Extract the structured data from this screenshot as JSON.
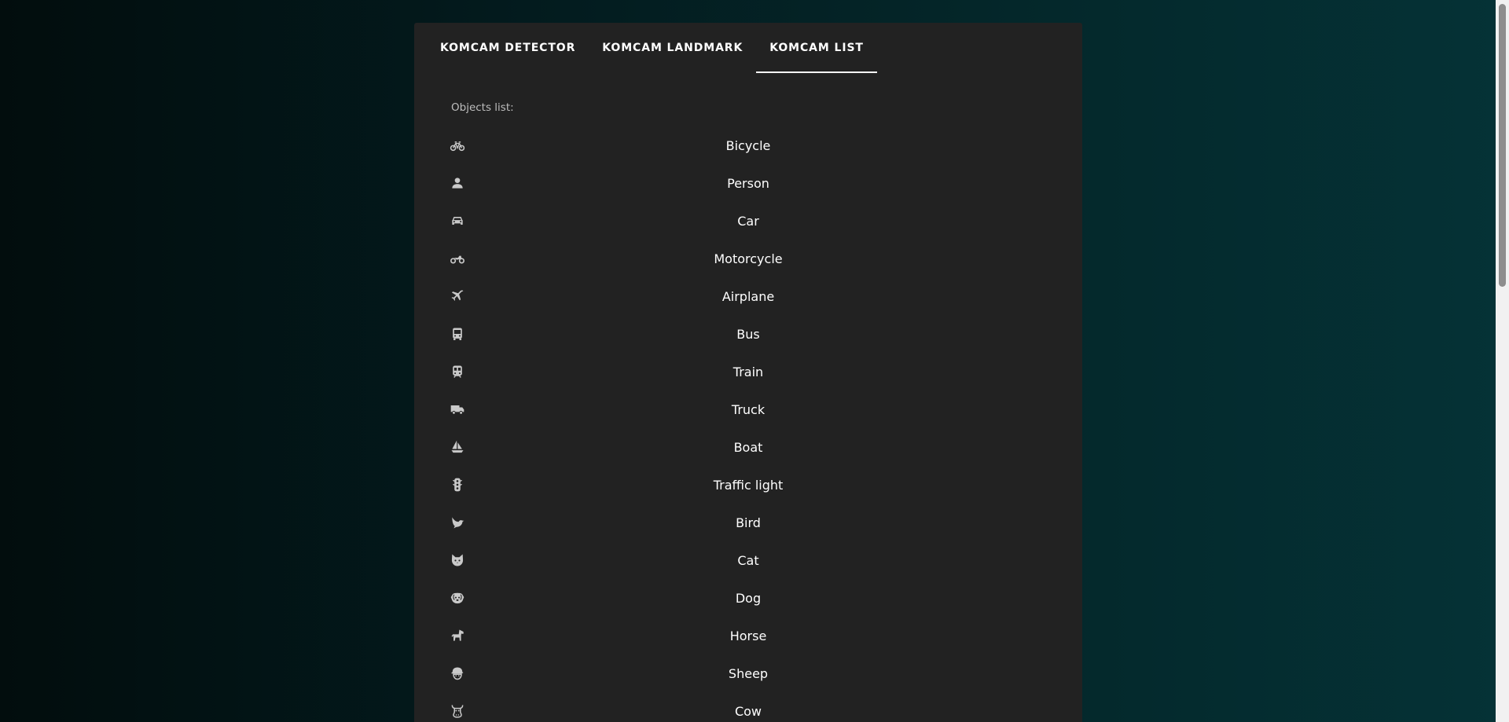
{
  "tabs": [
    {
      "label": "KOMCAM DETECTOR",
      "active": false
    },
    {
      "label": "KOMCAM LANDMARK",
      "active": false
    },
    {
      "label": "KOMCAM LIST",
      "active": true
    }
  ],
  "objects_label": "Objects list:",
  "objects": [
    {
      "label": "Bicycle",
      "icon": "bicycle-icon"
    },
    {
      "label": "Person",
      "icon": "person-icon"
    },
    {
      "label": "Car",
      "icon": "car-icon"
    },
    {
      "label": "Motorcycle",
      "icon": "motorcycle-icon"
    },
    {
      "label": "Airplane",
      "icon": "airplane-icon"
    },
    {
      "label": "Bus",
      "icon": "bus-icon"
    },
    {
      "label": "Train",
      "icon": "train-icon"
    },
    {
      "label": "Truck",
      "icon": "truck-icon"
    },
    {
      "label": "Boat",
      "icon": "boat-icon"
    },
    {
      "label": "Traffic light",
      "icon": "traffic-light-icon"
    },
    {
      "label": "Bird",
      "icon": "bird-icon"
    },
    {
      "label": "Cat",
      "icon": "cat-icon"
    },
    {
      "label": "Dog",
      "icon": "dog-icon"
    },
    {
      "label": "Horse",
      "icon": "horse-icon"
    },
    {
      "label": "Sheep",
      "icon": "sheep-icon"
    },
    {
      "label": "Cow",
      "icon": "cow-icon"
    }
  ],
  "colors": {
    "panel": "#222222",
    "tab_indicator": "#ffffff",
    "icon": "#c9c9c9",
    "label_muted": "#bdbdbd"
  }
}
